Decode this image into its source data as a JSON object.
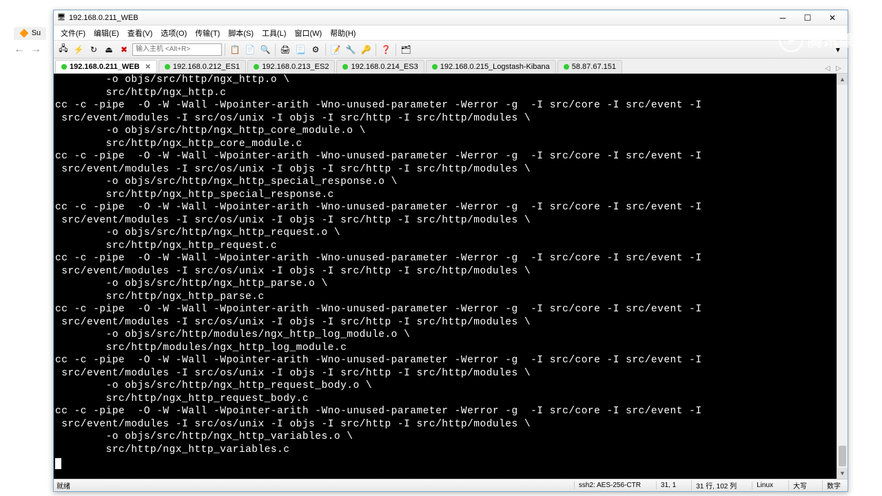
{
  "window": {
    "title": "192.168.0.211_WEB"
  },
  "browser_tab": "Su",
  "menu": {
    "file": "文件(F)",
    "edit": "编辑(E)",
    "view": "查看(V)",
    "options": "选项(O)",
    "transfer": "传输(T)",
    "script": "脚本(S)",
    "tools": "工具(L)",
    "window": "窗口(W)",
    "help": "帮助(H)"
  },
  "toolbar": {
    "host_placeholder": "输入主机 <Alt+R>"
  },
  "tabs": [
    {
      "label": "192.168.0.211_WEB",
      "active": true,
      "closable": true
    },
    {
      "label": "192.168.0.212_ES1",
      "active": false
    },
    {
      "label": "192.168.0.213_ES2",
      "active": false
    },
    {
      "label": "192.168.0.214_ES3",
      "active": false
    },
    {
      "label": "192.168.0.215_Logstash-Kibana",
      "active": false
    },
    {
      "label": "58.87.67.151",
      "active": false
    }
  ],
  "terminal_lines": [
    "        -o objs/src/http/ngx_http.o \\",
    "        src/http/ngx_http.c",
    "cc -c -pipe  -O -W -Wall -Wpointer-arith -Wno-unused-parameter -Werror -g  -I src/core -I src/event -I",
    " src/event/modules -I src/os/unix -I objs -I src/http -I src/http/modules \\",
    "        -o objs/src/http/ngx_http_core_module.o \\",
    "        src/http/ngx_http_core_module.c",
    "cc -c -pipe  -O -W -Wall -Wpointer-arith -Wno-unused-parameter -Werror -g  -I src/core -I src/event -I",
    " src/event/modules -I src/os/unix -I objs -I src/http -I src/http/modules \\",
    "        -o objs/src/http/ngx_http_special_response.o \\",
    "        src/http/ngx_http_special_response.c",
    "cc -c -pipe  -O -W -Wall -Wpointer-arith -Wno-unused-parameter -Werror -g  -I src/core -I src/event -I",
    " src/event/modules -I src/os/unix -I objs -I src/http -I src/http/modules \\",
    "        -o objs/src/http/ngx_http_request.o \\",
    "        src/http/ngx_http_request.c",
    "cc -c -pipe  -O -W -Wall -Wpointer-arith -Wno-unused-parameter -Werror -g  -I src/core -I src/event -I",
    " src/event/modules -I src/os/unix -I objs -I src/http -I src/http/modules \\",
    "        -o objs/src/http/ngx_http_parse.o \\",
    "        src/http/ngx_http_parse.c",
    "cc -c -pipe  -O -W -Wall -Wpointer-arith -Wno-unused-parameter -Werror -g  -I src/core -I src/event -I",
    " src/event/modules -I src/os/unix -I objs -I src/http -I src/http/modules \\",
    "        -o objs/src/http/modules/ngx_http_log_module.o \\",
    "        src/http/modules/ngx_http_log_module.c",
    "cc -c -pipe  -O -W -Wall -Wpointer-arith -Wno-unused-parameter -Werror -g  -I src/core -I src/event -I",
    " src/event/modules -I src/os/unix -I objs -I src/http -I src/http/modules \\",
    "        -o objs/src/http/ngx_http_request_body.o \\",
    "        src/http/ngx_http_request_body.c",
    "cc -c -pipe  -O -W -Wall -Wpointer-arith -Wno-unused-parameter -Werror -g  -I src/core -I src/event -I",
    " src/event/modules -I src/os/unix -I objs -I src/http -I src/http/modules \\",
    "        -o objs/src/http/ngx_http_variables.o \\",
    "        src/http/ngx_http_variables.c"
  ],
  "status": {
    "ready": "就绪",
    "ssh": "ssh2: AES-256-CTR",
    "pos": "31,  1",
    "size": "31 行, 102 列",
    "os": "Linux",
    "caps": "大写",
    "num": "数字"
  },
  "watermark": "腾讯课堂"
}
